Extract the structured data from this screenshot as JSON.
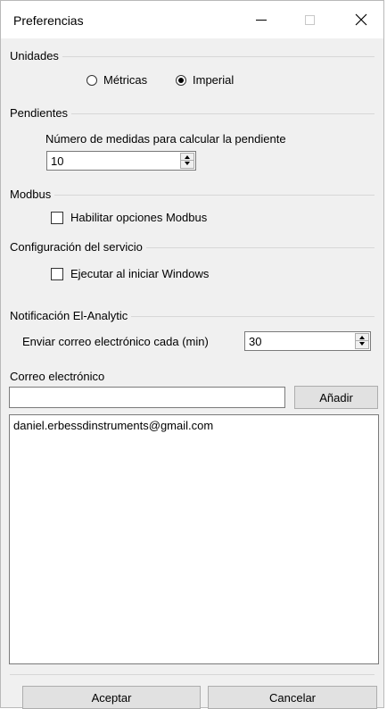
{
  "window": {
    "title": "Preferencias",
    "controls": {
      "minimize": "—",
      "maximize": "□",
      "close": "✕"
    }
  },
  "units": {
    "legend": "Unidades",
    "options": [
      "Métricas",
      "Imperial"
    ],
    "selected": "Imperial"
  },
  "slopes": {
    "legend": "Pendientes",
    "label": "Número de medidas para calcular la pendiente",
    "value": "10"
  },
  "modbus": {
    "legend": "Modbus",
    "checkbox_label": "Habilitar opciones Modbus",
    "checked": false
  },
  "service": {
    "legend": "Configuración del servicio",
    "checkbox_label": "Ejecutar al iniciar Windows",
    "checked": false
  },
  "notification": {
    "legend": "Notificación El-Analytic",
    "interval_label": "Enviar correo electrónico cada (min)",
    "interval_value": "30",
    "email_label": "Correo electrónico",
    "email_value": "",
    "add_button": "Añadir",
    "emails": [
      "daniel.erbessdinstruments@gmail.com"
    ]
  },
  "footer": {
    "accept": "Aceptar",
    "cancel": "Cancelar"
  }
}
